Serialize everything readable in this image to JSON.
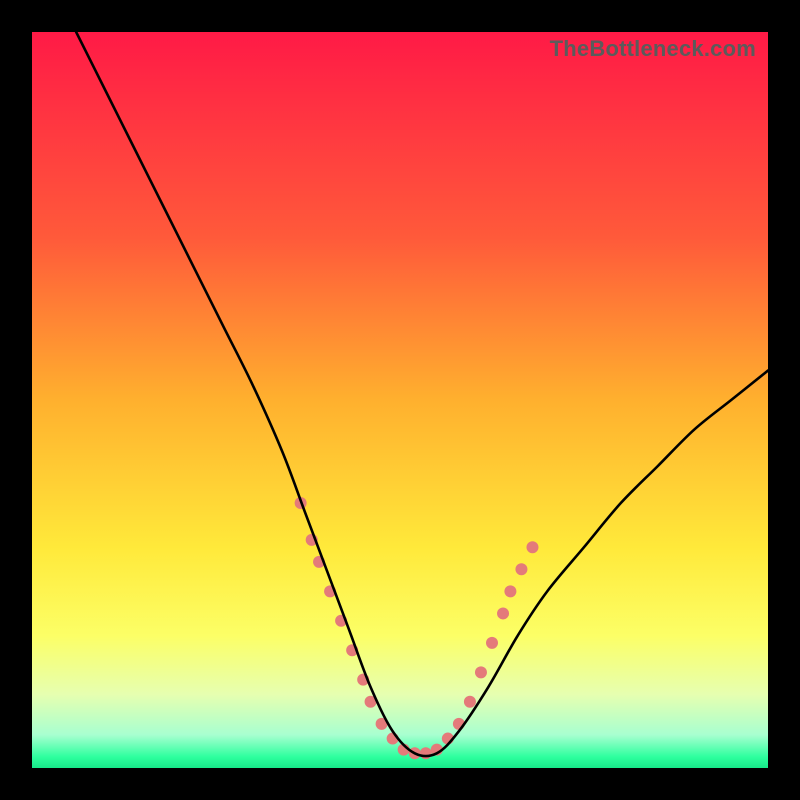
{
  "watermark": "TheBottleneck.com",
  "chart_data": {
    "type": "line",
    "title": "",
    "xlabel": "",
    "ylabel": "",
    "xlim": [
      0,
      100
    ],
    "ylim": [
      0,
      100
    ],
    "gradient_stops": [
      {
        "offset": 0,
        "color": "#ff1a46"
      },
      {
        "offset": 0.28,
        "color": "#ff5a3a"
      },
      {
        "offset": 0.5,
        "color": "#ffb02e"
      },
      {
        "offset": 0.7,
        "color": "#ffe93a"
      },
      {
        "offset": 0.82,
        "color": "#fcff66"
      },
      {
        "offset": 0.9,
        "color": "#e6ffb0"
      },
      {
        "offset": 0.955,
        "color": "#a8ffd0"
      },
      {
        "offset": 0.985,
        "color": "#2dff9e"
      },
      {
        "offset": 1.0,
        "color": "#17e889"
      }
    ],
    "series": [
      {
        "name": "bottleneck-curve",
        "color": "#000000",
        "x": [
          6,
          10,
          14,
          18,
          22,
          26,
          30,
          34,
          37,
          40,
          43,
          46,
          49,
          52,
          55,
          58,
          62,
          66,
          70,
          75,
          80,
          85,
          90,
          95,
          100
        ],
        "y": [
          100,
          92,
          84,
          76,
          68,
          60,
          52,
          43,
          35,
          27,
          19,
          11,
          5,
          2,
          2,
          5,
          11,
          18,
          24,
          30,
          36,
          41,
          46,
          50,
          54
        ]
      }
    ],
    "markers": {
      "name": "highlight-points",
      "color": "#e47a7a",
      "radius_px": 6,
      "points": [
        {
          "x": 36.5,
          "y": 36
        },
        {
          "x": 38.0,
          "y": 31
        },
        {
          "x": 39.0,
          "y": 28
        },
        {
          "x": 40.5,
          "y": 24
        },
        {
          "x": 42.0,
          "y": 20
        },
        {
          "x": 43.5,
          "y": 16
        },
        {
          "x": 45.0,
          "y": 12
        },
        {
          "x": 46.0,
          "y": 9
        },
        {
          "x": 47.5,
          "y": 6
        },
        {
          "x": 49.0,
          "y": 4
        },
        {
          "x": 50.5,
          "y": 2.5
        },
        {
          "x": 52.0,
          "y": 2
        },
        {
          "x": 53.5,
          "y": 2
        },
        {
          "x": 55.0,
          "y": 2.5
        },
        {
          "x": 56.5,
          "y": 4
        },
        {
          "x": 58.0,
          "y": 6
        },
        {
          "x": 59.5,
          "y": 9
        },
        {
          "x": 61.0,
          "y": 13
        },
        {
          "x": 62.5,
          "y": 17
        },
        {
          "x": 64.0,
          "y": 21
        },
        {
          "x": 65.0,
          "y": 24
        },
        {
          "x": 66.5,
          "y": 27
        },
        {
          "x": 68.0,
          "y": 30
        }
      ]
    }
  }
}
